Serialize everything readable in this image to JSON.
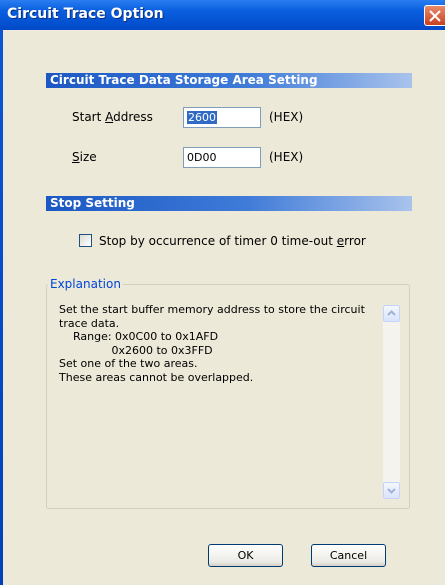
{
  "window": {
    "title": "Circuit Trace Option"
  },
  "storage_section": {
    "heading": "Circuit Trace Data Storage Area Setting",
    "start_address": {
      "label_pre": "Start ",
      "label_key": "A",
      "label_post": "ddress",
      "value": "2600",
      "unit": "(HEX)"
    },
    "size": {
      "label_key": "S",
      "label_post": "ize",
      "value": "0D00",
      "unit": "(HEX)"
    }
  },
  "stop_section": {
    "heading": "Stop Setting",
    "checkbox": {
      "label_pre": "Stop by occurrence of timer 0 time-out ",
      "label_key": "e",
      "label_post": "rror",
      "checked": false
    }
  },
  "explanation": {
    "legend": "Explanation",
    "lines": [
      "Set the start buffer memory address to store the circuit",
      "trace data.",
      "    Range: 0x0C00 to 0x1AFD",
      "               0x2600 to 0x3FFD",
      "Set one of the two areas.",
      "These areas cannot be overlapped."
    ]
  },
  "buttons": {
    "ok": "OK",
    "cancel": "Cancel"
  },
  "icons": {
    "close": "close-icon",
    "scroll_up": "arrow-up-icon",
    "scroll_down": "arrow-down-icon"
  },
  "colors": {
    "titlebar": "#0a5fe0",
    "section_bar": "#1b58c4",
    "client_bg": "#ece9d8",
    "legend": "#0046d5",
    "selection": "#316ac5"
  }
}
